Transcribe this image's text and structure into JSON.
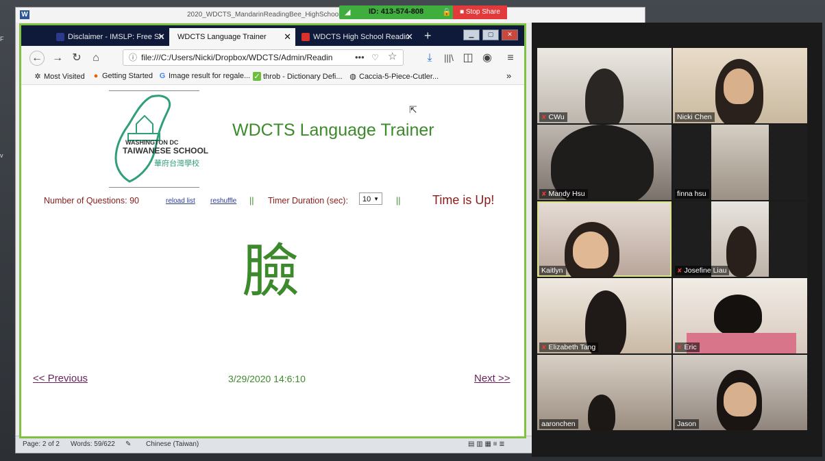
{
  "word": {
    "logo_letter": "W",
    "title": "2020_WDCTS_MandarinReadingBee_HighSchool",
    "status": {
      "page": "Page: 2 of 2",
      "words": "Words: 59/622",
      "language": "Chinese (Taiwan)"
    }
  },
  "zoom": {
    "meeting_id": "ID: 413-574-808",
    "stop_share": "Stop Share"
  },
  "browser": {
    "tabs": [
      {
        "label": "Disclaimer - IMSLP: Free Sh",
        "active": false
      },
      {
        "label": "WDCTS Language Trainer",
        "active": true
      },
      {
        "label": "WDCTS High School Readin",
        "active": false
      }
    ],
    "url": "file:///C:/Users/Nicki/Dropbox/WDCTS/Admin/Readin",
    "bookmarks": [
      {
        "icon": "✲",
        "label": "Most Visited"
      },
      {
        "icon": "●",
        "label": "Getting Started"
      },
      {
        "icon": "G",
        "label": "Image result for regale..."
      },
      {
        "icon": "✓",
        "label": "throb - Dictionary Defi..."
      },
      {
        "icon": "◍",
        "label": "Caccia-5-Piece-Cutler..."
      }
    ]
  },
  "trainer": {
    "logo_line1": "WASHINGTON DC",
    "logo_line2": "TAIWANESE SCHOOL",
    "logo_cn": "華府台灣學校",
    "title": "WDCTS Language Trainer",
    "num_questions_label": "Number of Questions:",
    "num_questions": "90",
    "reload_list": "reload list",
    "reshuffle": "reshuffle",
    "separator": "||",
    "timer_label": "Timer Duration (sec):",
    "timer_value": "10",
    "time_up": "Time is Up!",
    "character": "臉",
    "prev": "<< Previous",
    "timestamp": "3/29/2020 14:6:10",
    "next": "Next >>"
  },
  "participants": [
    {
      "name": "CWu",
      "muted": true
    },
    {
      "name": "Nicki Chen",
      "muted": false
    },
    {
      "name": "Mandy Hsu",
      "muted": true
    },
    {
      "name": "finna hsu",
      "muted": false
    },
    {
      "name": "Kaitlyn",
      "muted": false,
      "speaking": true
    },
    {
      "name": "Josefine Liau",
      "muted": true
    },
    {
      "name": "Elizabeth Tang",
      "muted": true
    },
    {
      "name": "Eric",
      "muted": true
    },
    {
      "name": "aaronchen",
      "muted": false
    },
    {
      "name": "Jason",
      "muted": false
    }
  ],
  "colors": {
    "accent_green": "#3c8a2b",
    "dark_red": "#8b1a1a",
    "zoom_green": "#3fae3f",
    "stop_red": "#e23a3a"
  }
}
